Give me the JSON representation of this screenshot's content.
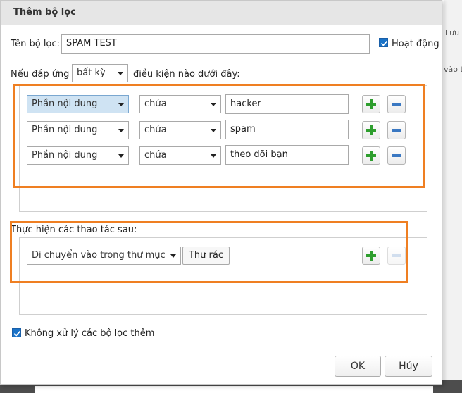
{
  "dialog": {
    "title": "Thêm bộ lọc",
    "filter_name_label": "Tên bộ lọc:",
    "filter_name_value": "SPAM TEST",
    "active_label": "Hoạt động",
    "match_prefix": "Nếu đáp ứng",
    "match_option": "bất kỳ",
    "match_suffix": "điều kiện nào dưới đây:",
    "conditions": [
      {
        "field": "Phần nội dung",
        "operator": "chứa",
        "value": "hacker"
      },
      {
        "field": "Phần nội dung",
        "operator": "chứa",
        "value": "spam"
      },
      {
        "field": "Phần nội dung",
        "operator": "chứa",
        "value": "theo dõi bạn"
      }
    ],
    "actions_label": "Thực hiện các thao tác sau:",
    "action": {
      "type": "Di chuyển vào trong thư mục",
      "folder": "Thư rác"
    },
    "stop_label": "Không xử lý các bộ lọc thêm",
    "ok_label": "OK",
    "cancel_label": "Hủy"
  },
  "background": {
    "save_fragment": "Lưu",
    "to_fragment": "vào t"
  },
  "colors": {
    "highlight": "#ef7f22",
    "checkbox": "#1a73c8",
    "plus_green": "#2e9e2e",
    "minus_blue": "#3a78c2"
  }
}
